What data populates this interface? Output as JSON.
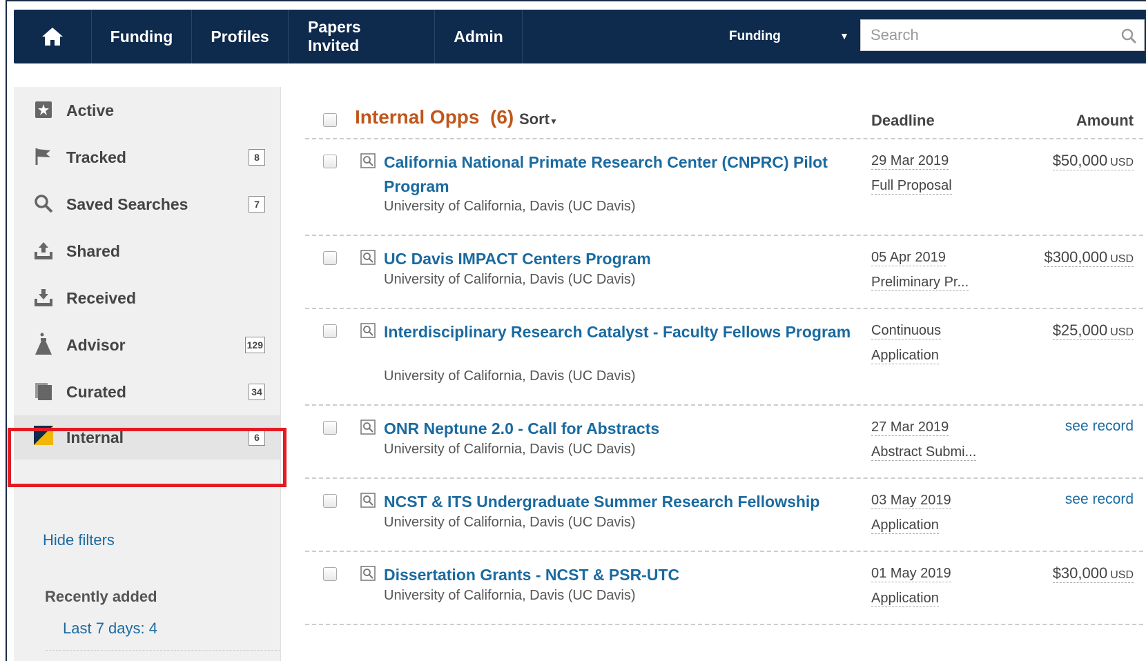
{
  "nav": {
    "items": [
      "Funding",
      "Profiles",
      "Papers Invited",
      "Admin"
    ],
    "scope": "Funding",
    "search_placeholder": "Search"
  },
  "sidebar": {
    "items": [
      {
        "label": "Active",
        "badge": "",
        "icon": "star-icon"
      },
      {
        "label": "Tracked",
        "badge": "8",
        "icon": "flag-icon"
      },
      {
        "label": "Saved Searches",
        "badge": "7",
        "icon": "search-icon"
      },
      {
        "label": "Shared",
        "badge": "",
        "icon": "share-icon"
      },
      {
        "label": "Received",
        "badge": "",
        "icon": "inbox-icon"
      },
      {
        "label": "Advisor",
        "badge": "129",
        "icon": "advisor-icon"
      },
      {
        "label": "Curated",
        "badge": "34",
        "icon": "documents-icon"
      },
      {
        "label": "Internal",
        "badge": "6",
        "icon": "internal-flag-icon"
      }
    ],
    "hide_filters": "Hide filters",
    "recent_title": "Recently added",
    "recent_link": "Last 7 days: 4"
  },
  "list": {
    "title": "Internal Opps",
    "count": "(6)",
    "sort": "Sort",
    "col_deadline": "Deadline",
    "col_amount": "Amount",
    "rows": [
      {
        "title": "California National Primate Research Center (CNPRC) Pilot Program",
        "institution": "University of California, Davis (UC Davis)",
        "deadline": "29 Mar 2019",
        "type": "Full Proposal",
        "amount": "$50,000",
        "currency": "USD",
        "link": ""
      },
      {
        "title": "UC Davis IMPACT Centers Program",
        "institution": "University of California, Davis (UC Davis)",
        "deadline": "05 Apr 2019",
        "type": "Preliminary Pr...",
        "amount": "$300,000",
        "currency": "USD",
        "link": ""
      },
      {
        "title": "Interdisciplinary Research Catalyst - Faculty Fellows Program",
        "institution": "University of California, Davis (UC Davis)",
        "deadline": "Continuous",
        "type": "Application",
        "amount": "$25,000",
        "currency": "USD",
        "link": ""
      },
      {
        "title": "ONR Neptune 2.0 - Call for Abstracts",
        "institution": "University of California, Davis (UC Davis)",
        "deadline": "27 Mar 2019",
        "type": "Abstract Submi...",
        "amount": "",
        "currency": "",
        "link": "see record"
      },
      {
        "title": "NCST & ITS Undergraduate Summer Research Fellowship",
        "institution": "University of California, Davis (UC Davis)",
        "deadline": "03 May 2019",
        "type": "Application",
        "amount": "",
        "currency": "",
        "link": "see record"
      },
      {
        "title": "Dissertation Grants - NCST & PSR-UTC",
        "institution": "University of California, Davis (UC Davis)",
        "deadline": "01 May 2019",
        "type": "Application",
        "amount": "$30,000",
        "currency": "USD",
        "link": ""
      }
    ]
  }
}
